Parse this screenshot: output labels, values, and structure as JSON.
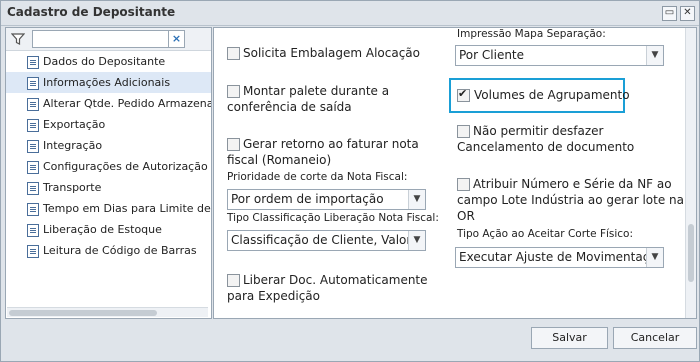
{
  "window": {
    "title": "Cadastro de Depositante",
    "restore_glyph": "▭",
    "close_glyph": "✕"
  },
  "sidebar": {
    "filter_placeholder": "",
    "filter_clear": "×",
    "items": [
      {
        "label": "Dados do Depositante",
        "selected": false
      },
      {
        "label": "Informações Adicionais",
        "selected": true
      },
      {
        "label": "Alterar Qtde. Pedido Armazenagem",
        "selected": false
      },
      {
        "label": "Exportação",
        "selected": false
      },
      {
        "label": "Integração",
        "selected": false
      },
      {
        "label": "Configurações de Autorização para",
        "selected": false
      },
      {
        "label": "Transporte",
        "selected": false
      },
      {
        "label": "Tempo em Dias para Limite de Oper",
        "selected": false
      },
      {
        "label": "Liberação de Estoque",
        "selected": false
      },
      {
        "label": "Leitura de Código de Barras",
        "selected": false
      }
    ]
  },
  "form": {
    "solicita_embalagem": {
      "label": "Solicita Embalagem Alocação",
      "checked": false
    },
    "montar_palete": {
      "label_line1": "Montar palete durante a",
      "label_line2": "conferência de saída",
      "checked": false
    },
    "gerar_retorno": {
      "label_line1": "Gerar retorno ao faturar nota",
      "label_line2": "fiscal (Romaneio)",
      "checked": false
    },
    "prioridade_corte": {
      "caption": "Prioridade de corte da Nota Fiscal:",
      "value": "Por ordem de importação"
    },
    "tipo_classificacao": {
      "caption": "Tipo Classificação Liberação Nota Fiscal:",
      "value": "Classificação de Cliente, Valor de"
    },
    "liberar_doc": {
      "label_line1": "Liberar Doc. Automaticamente",
      "label_line2": "para Expedição",
      "checked": false
    },
    "impressao_mapa": {
      "caption": "Impressão Mapa Separação:",
      "value": "Por Cliente"
    },
    "volumes_agrupamento": {
      "label": "Volumes de Agrupamento",
      "checked": true
    },
    "nao_permitir_desfazer": {
      "label_line1": "Não permitir desfazer",
      "label_line2": "Cancelamento de documento",
      "checked": false
    },
    "atribuir_numero": {
      "label_line1": "Atribuir Número e Série da NF ao",
      "label_line2": "campo Lote Indústria ao gerar lote na",
      "label_line3": "OR",
      "checked": false
    },
    "tipo_acao_corte": {
      "caption": "Tipo Ação ao Aceitar Corte Físico:",
      "value": "Executar Ajuste de Movimentação"
    }
  },
  "footer": {
    "save_label": "Salvar",
    "cancel_label": "Cancelar"
  },
  "colors": {
    "highlight": "#1a9fd6",
    "selected_row": "#dde8f6"
  },
  "icons": {
    "filter": "filter-icon",
    "doc": "document-icon",
    "dropdown": "chevron-down-icon"
  }
}
